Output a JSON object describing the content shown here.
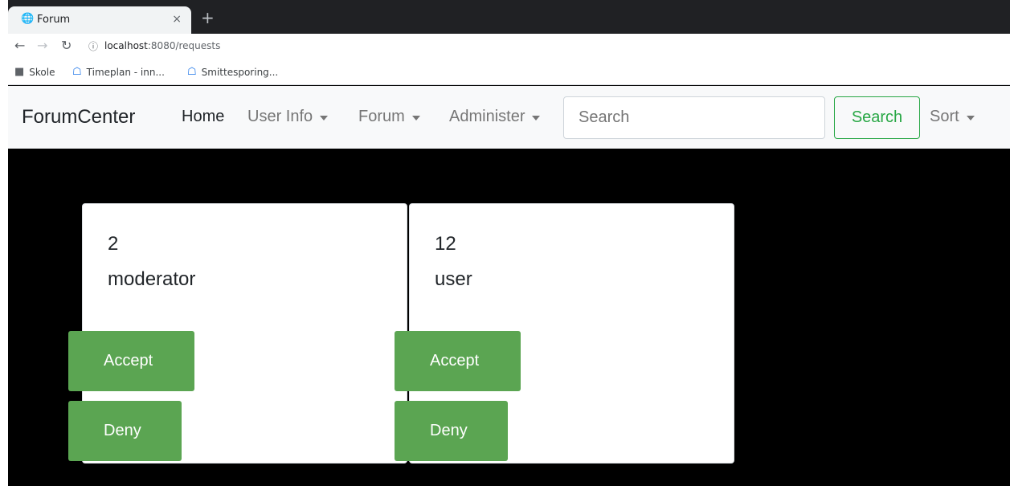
{
  "browser": {
    "tab_title": "Forum",
    "tab_close": "×",
    "new_tab": "+",
    "url_host": "localhost",
    "url_path": ":8080/requests",
    "bookmarks": [
      "Skole",
      "Timeplan - inn...",
      "Smittesporing..."
    ]
  },
  "navbar": {
    "brand": "ForumCenter",
    "items": [
      {
        "label": "Home",
        "active": true,
        "dropdown": false
      },
      {
        "label": "User Info",
        "dropdown": true
      },
      {
        "label": "Forum",
        "dropdown": true
      },
      {
        "label": "Administer",
        "dropdown": true
      }
    ],
    "search_placeholder": "Search",
    "search_button": "Search",
    "sort_label": "Sort"
  },
  "requests": [
    {
      "id": "2",
      "role": "moderator",
      "accept": "Accept",
      "deny": "Deny"
    },
    {
      "id": "12",
      "role": "user",
      "accept": "Accept",
      "deny": "Deny"
    }
  ],
  "colors": {
    "success": "#28a745",
    "button_fill": "#5ba552",
    "page_background": "#000000"
  }
}
